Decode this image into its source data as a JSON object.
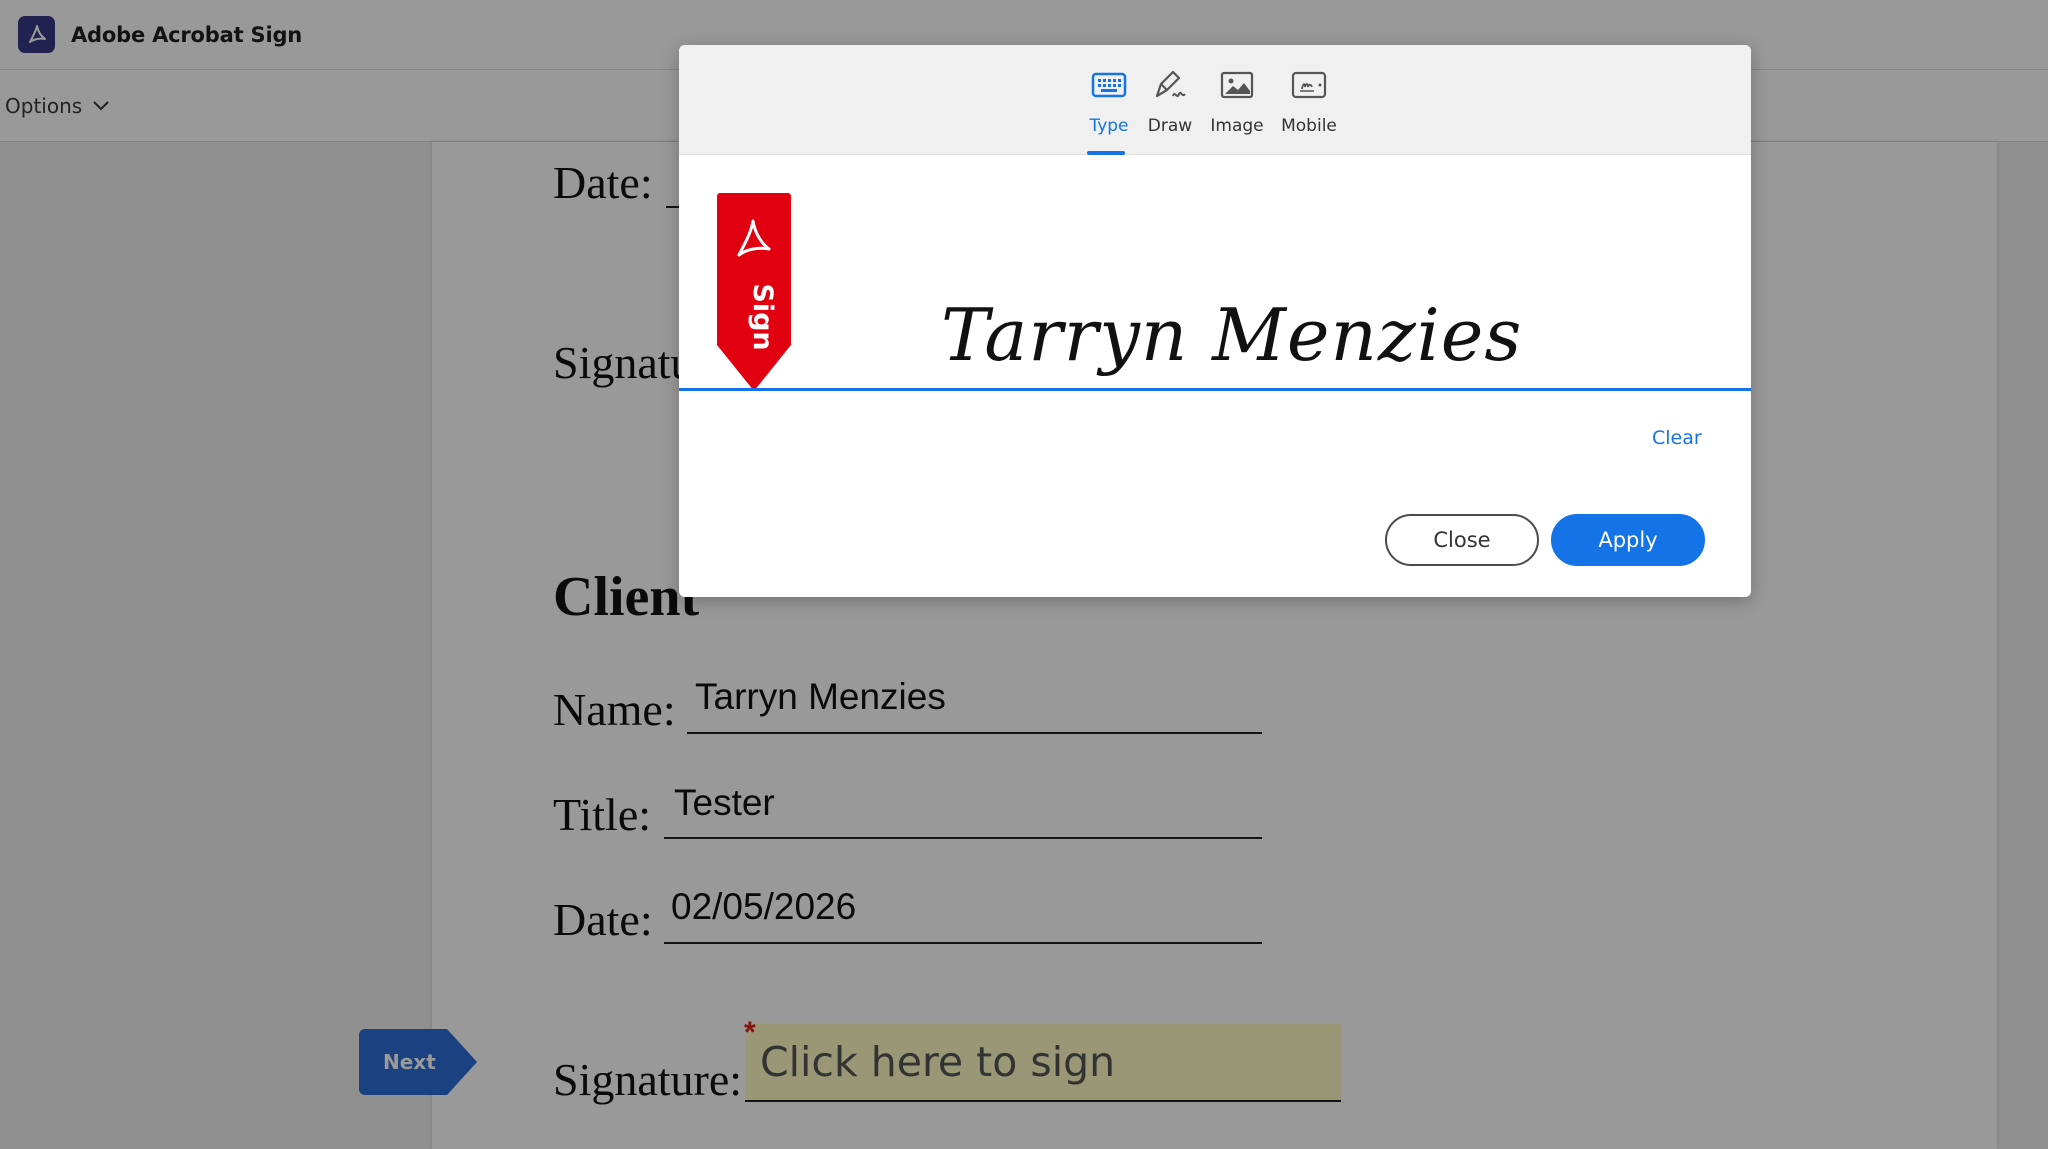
{
  "app": {
    "title": "Adobe Acrobat Sign",
    "logo_icon": "acrobat-icon",
    "brand_color": "#3a3a86"
  },
  "options_bar": {
    "label": "Options",
    "icon": "chevron-down-icon"
  },
  "document": {
    "date_label_top": "Date:",
    "signature_label_top": "Signatu",
    "client_heading": "Client",
    "name_label": "Name:",
    "name_value": "Tarryn Menzies",
    "title_label": "Title:",
    "title_value": "Tester",
    "date_label": "Date:",
    "date_value": "02/05/2026",
    "signature_label": "Signature:",
    "signature_placeholder": "Click here to sign",
    "required_mark": "*",
    "next_label": "Next"
  },
  "modal": {
    "tabs": [
      {
        "label": "Type",
        "icon": "keyboard-icon",
        "active": true
      },
      {
        "label": "Draw",
        "icon": "pen-icon",
        "active": false
      },
      {
        "label": "Image",
        "icon": "image-icon",
        "active": false
      },
      {
        "label": "Mobile",
        "icon": "mobile-icon",
        "active": false
      }
    ],
    "ribbon_label": "Sign",
    "signature_text": "Tarryn Menzies",
    "clear_label": "Clear",
    "close_label": "Close",
    "apply_label": "Apply",
    "accent_color": "#1473e6",
    "ribbon_color": "#e1000f"
  }
}
